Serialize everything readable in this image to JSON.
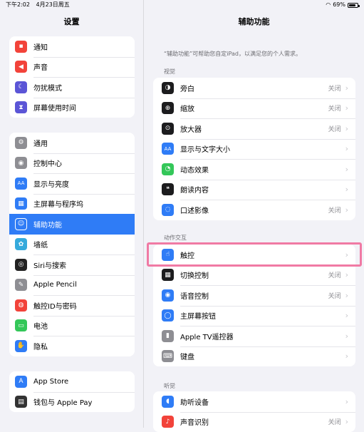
{
  "status_bar": {
    "time": "下午2:02",
    "date": "4月23日周五",
    "battery": "69%"
  },
  "sidebar": {
    "title": "设置",
    "group1": [
      {
        "label": "通知",
        "icon": "bell-icon",
        "color": "#f2433a"
      },
      {
        "label": "声音",
        "icon": "speaker-icon",
        "color": "#f2433a"
      },
      {
        "label": "勿扰模式",
        "icon": "moon-icon",
        "color": "#5b55d6"
      },
      {
        "label": "屏幕使用时间",
        "icon": "hourglass-icon",
        "color": "#5b55d6"
      }
    ],
    "group2": [
      {
        "label": "通用",
        "icon": "gear-icon",
        "color": "#8e8e93"
      },
      {
        "label": "控制中心",
        "icon": "switches-icon",
        "color": "#8e8e93"
      },
      {
        "label": "显示与亮度",
        "icon": "text-size-icon",
        "color": "#2f7cf6"
      },
      {
        "label": "主屏幕与程序坞",
        "icon": "grid-icon",
        "color": "#2f7cf6"
      },
      {
        "label": "辅助功能",
        "icon": "accessibility-icon",
        "color": "#2f7cf6",
        "selected": true
      },
      {
        "label": "墙纸",
        "icon": "flower-icon",
        "color": "#35aadc"
      },
      {
        "label": "Siri与搜索",
        "icon": "siri-icon",
        "color": "#222222"
      },
      {
        "label": "Apple Pencil",
        "icon": "pencil-icon",
        "color": "#8e8e93"
      },
      {
        "label": "触控ID与密码",
        "icon": "fingerprint-icon",
        "color": "#f2433a"
      },
      {
        "label": "电池",
        "icon": "battery-icon",
        "color": "#34c759"
      },
      {
        "label": "隐私",
        "icon": "hand-icon",
        "color": "#2f7cf6"
      }
    ],
    "group3": [
      {
        "label": "App Store",
        "icon": "appstore-icon",
        "color": "#2f7cf6"
      },
      {
        "label": "钱包与 Apple Pay",
        "icon": "wallet-icon",
        "color": "#333333"
      }
    ]
  },
  "main": {
    "title": "辅助功能",
    "description": "“辅助功能”可帮助您自定iPad，以满足您的个人需求。",
    "sections": [
      {
        "header": "视觉",
        "rows": [
          {
            "label": "旁白",
            "value": "关闭",
            "icon": "voiceover-icon",
            "color": "#1c1c1e"
          },
          {
            "label": "缩放",
            "value": "关闭",
            "icon": "zoom-icon",
            "color": "#1c1c1e"
          },
          {
            "label": "放大器",
            "value": "关闭",
            "icon": "magnifier-icon",
            "color": "#1c1c1e"
          },
          {
            "label": "显示与文字大小",
            "value": "",
            "icon": "text-size-icon",
            "color": "#2f7cf6"
          },
          {
            "label": "动态效果",
            "value": "",
            "icon": "motion-icon",
            "color": "#34c759"
          },
          {
            "label": "朗读内容",
            "value": "",
            "icon": "speech-bubble-icon",
            "color": "#1c1c1e"
          },
          {
            "label": "口述影像",
            "value": "关闭",
            "icon": "audio-description-icon",
            "color": "#2f7cf6"
          }
        ]
      },
      {
        "header": "动作交互",
        "rows": [
          {
            "label": "触控",
            "value": "",
            "icon": "touch-hand-icon",
            "color": "#2f7cf6"
          },
          {
            "label": "切换控制",
            "value": "关闭",
            "icon": "switch-control-icon",
            "color": "#1c1c1e"
          },
          {
            "label": "语音控制",
            "value": "关闭",
            "icon": "voice-control-icon",
            "color": "#2f7cf6"
          },
          {
            "label": "主屏幕按钮",
            "value": "",
            "icon": "home-button-icon",
            "color": "#2f7cf6"
          },
          {
            "label": "Apple TV遥控器",
            "value": "",
            "icon": "remote-icon",
            "color": "#8e8e93"
          },
          {
            "label": "键盘",
            "value": "",
            "icon": "keyboard-icon",
            "color": "#8e8e93"
          }
        ]
      },
      {
        "header": "听觉",
        "rows": [
          {
            "label": "助听设备",
            "value": "",
            "icon": "ear-icon",
            "color": "#2f7cf6"
          },
          {
            "label": "声音识别",
            "value": "关闭",
            "icon": "sound-recognition-icon",
            "color": "#f2433a"
          }
        ]
      }
    ]
  }
}
